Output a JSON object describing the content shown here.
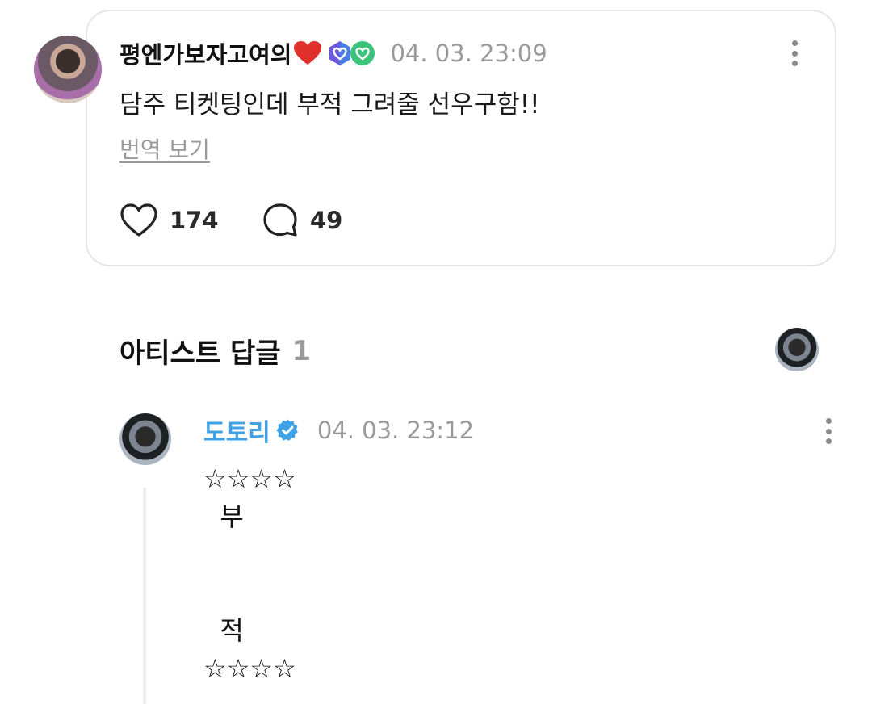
{
  "post": {
    "author": "평엔가보자고여의",
    "author_emoji": "heart-emoji",
    "badges": [
      "membership-badge-icon",
      "fan-badge-icon"
    ],
    "timestamp": "04. 03. 23:09",
    "text": "담주 티켓팅인데 부적 그려줄 선우구함!!",
    "translate_label": "번역 보기",
    "likes": "174",
    "comments": "49"
  },
  "artist_replies": {
    "title": "아티스트 답글",
    "count": "1"
  },
  "reply": {
    "author": "도토리",
    "timestamp": "04. 03. 23:12",
    "body": "☆☆☆☆\n  부\n\n\n  적\n☆☆☆☆"
  },
  "colors": {
    "accent_blue": "#3fa2e6",
    "muted_gray": "#9a9a9a",
    "card_border": "#e6e6e6",
    "heart_red": "#e0302c",
    "badge_purple": "#6a5ae0",
    "badge_green": "#3cc47c"
  }
}
